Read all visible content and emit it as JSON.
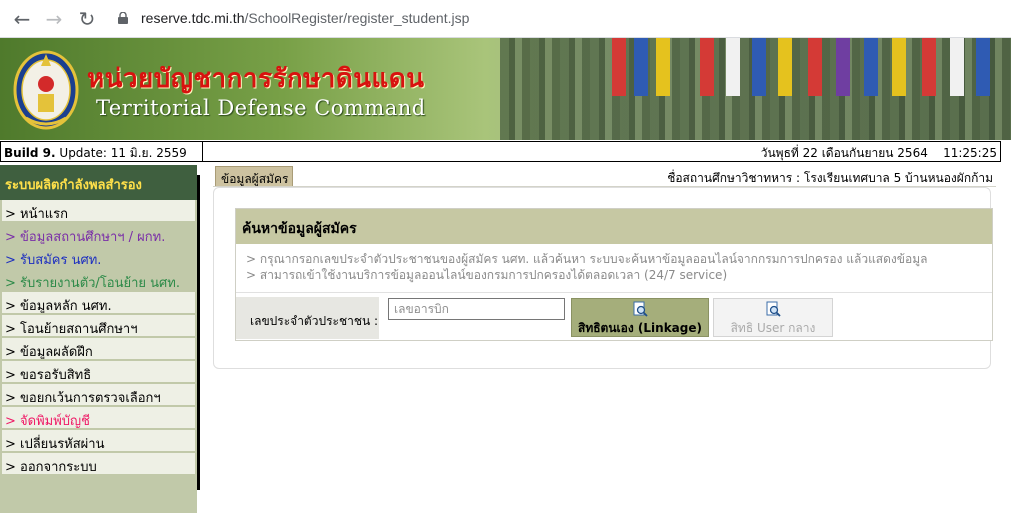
{
  "browser": {
    "url_host": "reserve.tdc.mi.th",
    "url_path": "/SchoolRegister/register_student.jsp"
  },
  "banner": {
    "title_th": "หน่วยบัญชาการรักษาดินแดน",
    "title_en": "Territorial Defense Command"
  },
  "status": {
    "build_label": "Build 9.",
    "update_text": " Update: 11 มิ.ย. 2559",
    "datetime": "วันพุธที่ 22 เดือนกันยายน 2564    11:25:25"
  },
  "sidebar": {
    "header": "ระบบผลิตกำลังพลสำรอง",
    "items": [
      {
        "label": "> หน้าแรก",
        "color": "#000000"
      },
      {
        "label": "> ข้อมูลสถานศึกษาฯ / ผกท.",
        "color": "#7a2fa8"
      },
      {
        "label": "> รับสมัคร นศท.",
        "color": "#1d2fc0"
      },
      {
        "label": "> รับรายงานตัว/โอนย้าย นศท.",
        "color": "#2c8a48"
      },
      {
        "label": "> ข้อมูลหลัก นศท.",
        "color": "#000000"
      },
      {
        "label": "> โอนย้ายสถานศึกษาฯ",
        "color": "#000000"
      },
      {
        "label": "> ข้อมูลผลัดฝึก",
        "color": "#000000"
      },
      {
        "label": "> ขอรอรับสิทธิ",
        "color": "#000000"
      },
      {
        "label": "> ขอยกเว้นการตรวจเลือกฯ",
        "color": "#000000"
      },
      {
        "label": "> จัดพิมพ์บัญชี",
        "color": "#ef1a66"
      },
      {
        "label": "> เปลี่ยนรหัสผ่าน",
        "color": "#000000"
      },
      {
        "label": "> ออกจากระบบ",
        "color": "#000000"
      }
    ]
  },
  "main": {
    "tab_label": "ข้อมูลผู้สมัคร",
    "school_line": "ชื่อสถานศึกษาวิชาทหาร : โรงเรียนเทศบาล 5 บ้านหนองผักก้าม",
    "search": {
      "title": "ค้นหาข้อมูลผู้สมัคร",
      "note1": "> กรุณากรอกเลขประจำตัวประชาชนของผู้สมัคร นศท. แล้วค้นหา ระบบจะค้นหาข้อมูลออนไลน์จากกรมการปกครอง แล้วแสดงข้อมูล",
      "note2": "> สามารถเข้าใช้งานบริการข้อมูลออนไลน์ของกรมการปกครองได้ตลอดเวลา (24/7 service)",
      "id_label": "เลขประจำตัวประชาชน :",
      "id_placeholder": "เลขอารบิก",
      "id_value": "",
      "btn_linkage": "สิทธิตนเอง (Linkage)",
      "btn_central": "สิทธิ User กลาง",
      "icon": "magnifier-document-icon"
    }
  }
}
